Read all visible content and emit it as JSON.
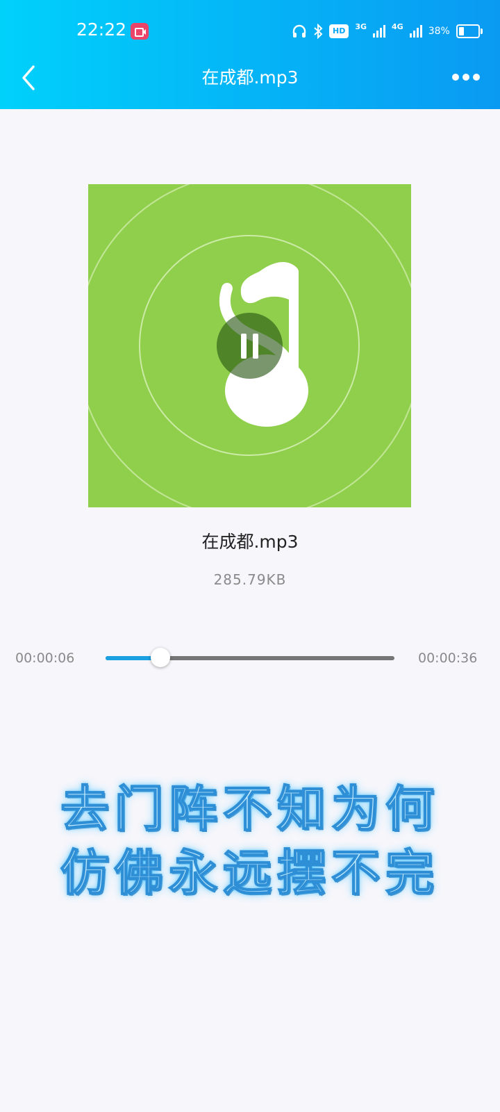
{
  "status_bar": {
    "time": "22:22",
    "hd_label": "HD",
    "network_1": "3G",
    "network_2": "4G",
    "battery_text": "38%",
    "battery_level": 0.38
  },
  "header": {
    "title": "在成都.mp3",
    "back_icon": "chevron-left-icon",
    "more_icon": "more-horizontal-icon"
  },
  "player": {
    "album_art_icon": "music-note-icon",
    "control_icon": "pause-icon",
    "track_name": "在成都.mp3",
    "file_size": "285.79KB",
    "elapsed": "00:00:06",
    "duration": "00:00:36",
    "progress": 0.19
  },
  "lyrics": {
    "line1": "去门阵不知为何",
    "line2": "仿佛永远摆不完"
  },
  "colors": {
    "header_start": "#00d1fb",
    "header_end": "#0a9af2",
    "album_bg": "#8fcf4c",
    "progress_fill": "#1a9fe0",
    "progress_track": "#767676",
    "background": "#f7f6fb"
  }
}
